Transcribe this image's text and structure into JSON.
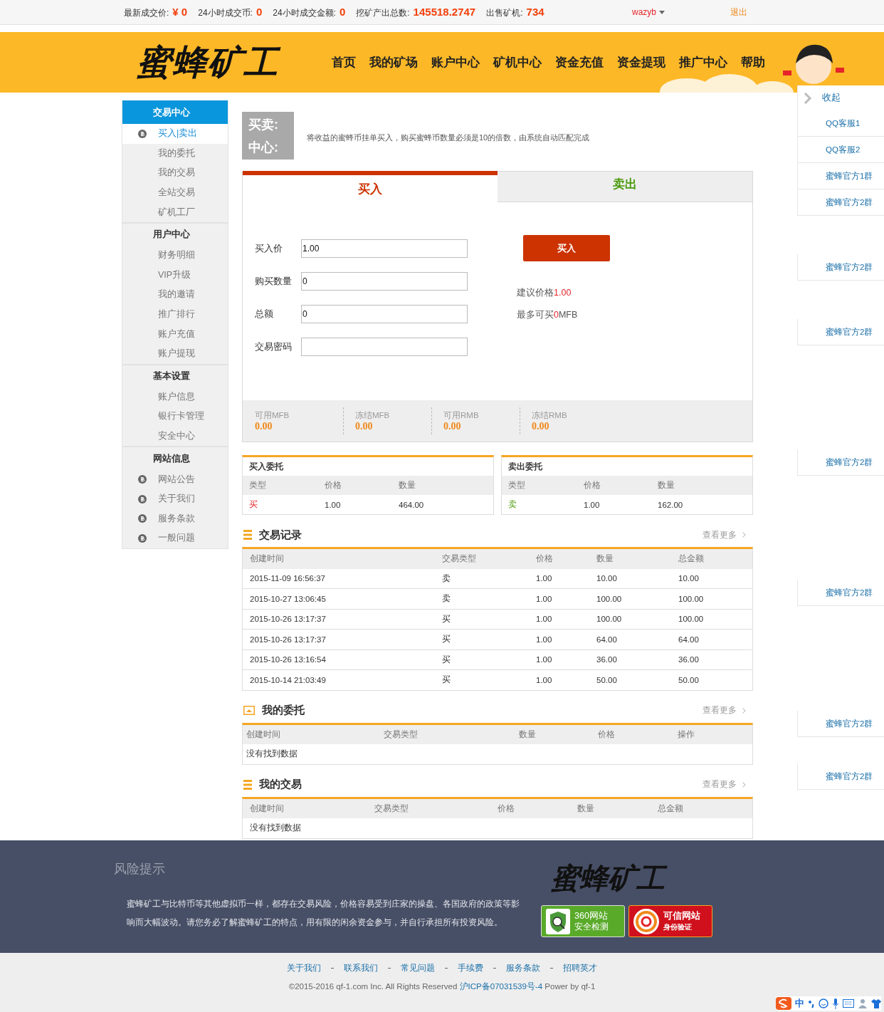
{
  "top_bar": {
    "stats": [
      {
        "label": "最新成交价:",
        "value": "¥ 0"
      },
      {
        "label": "24小时成交币:",
        "value": "0"
      },
      {
        "label": "24小时成交金额:",
        "value": "0"
      },
      {
        "label": "挖矿产出总数:",
        "value": "145518.2747"
      },
      {
        "label": "出售矿机:",
        "value": "734"
      }
    ],
    "user": "wazyb",
    "logout": "退出"
  },
  "header": {
    "logo": "蜜蜂矿工",
    "nav": [
      "首页",
      "我的矿场",
      "账户中心",
      "矿机中心",
      "资金充值",
      "资金提现",
      "推广中心",
      "帮助"
    ]
  },
  "sidebar": {
    "groups": [
      {
        "title": "交易中心",
        "selected": true,
        "items": [
          {
            "label": "买入|卖出",
            "kind": "icon",
            "selected": true
          },
          {
            "label": "我的委托",
            "kind": "plain",
            "selected": false
          },
          {
            "label": "我的交易",
            "kind": "plain",
            "selected": false
          },
          {
            "label": "全站交易",
            "kind": "plain",
            "selected": false
          },
          {
            "label": "矿机工厂",
            "kind": "plain",
            "selected": false
          }
        ]
      },
      {
        "title": "用户中心",
        "selected": false,
        "items": [
          {
            "label": "财务明细",
            "kind": "plain",
            "selected": false
          },
          {
            "label": "VIP升级",
            "kind": "plain",
            "selected": false
          },
          {
            "label": "我的邀请",
            "kind": "plain",
            "selected": false
          },
          {
            "label": "推广排行",
            "kind": "plain",
            "selected": false
          },
          {
            "label": "账户充值",
            "kind": "plain",
            "selected": false
          },
          {
            "label": "账户提现",
            "kind": "plain",
            "selected": false
          }
        ]
      },
      {
        "title": "基本设置",
        "selected": false,
        "items": [
          {
            "label": "账户信息",
            "kind": "plain",
            "selected": false
          },
          {
            "label": "银行卡管理",
            "kind": "plain",
            "selected": false
          },
          {
            "label": "安全中心",
            "kind": "plain",
            "selected": false
          }
        ]
      },
      {
        "title": "网站信息",
        "selected": false,
        "items": [
          {
            "label": "网站公告",
            "kind": "icon",
            "selected": false
          },
          {
            "label": "关于我们",
            "kind": "icon",
            "selected": false
          },
          {
            "label": "服务条款",
            "kind": "icon",
            "selected": false
          },
          {
            "label": "一般问题",
            "kind": "icon",
            "selected": false
          }
        ]
      }
    ]
  },
  "notice": {
    "title": [
      "买卖:",
      "中心:"
    ],
    "text": "将收益的蜜蜂币挂单买入，购买蜜蜂币数量必须是10的倍数，由系统自动匹配完成"
  },
  "trade_panel": {
    "tabs": [
      {
        "label": "买入",
        "kind": "buy",
        "selected": true
      },
      {
        "label": "卖出",
        "kind": "sell",
        "selected": false
      }
    ],
    "fields": [
      {
        "label": "买入价",
        "value": "1.00"
      },
      {
        "label": "购买数量",
        "value": "0"
      },
      {
        "label": "总额",
        "value": "0"
      },
      {
        "label": "交易密码"
      }
    ],
    "submit": "买入",
    "hints": [
      {
        "label": "建议价格",
        "value": "1.00"
      },
      {
        "label": "最多可买",
        "value": "0",
        "unit": "MFB"
      }
    ],
    "balances": [
      {
        "label": "可用MFB",
        "value": "0.00"
      },
      {
        "label": "冻结MFB",
        "value": "0.00"
      },
      {
        "label": "可用RMB",
        "value": "0.00"
      },
      {
        "label": "冻结RMB",
        "value": "0.00"
      }
    ]
  },
  "order_books": [
    {
      "title": "买入委托",
      "columns": [
        "类型",
        "价格",
        "数量"
      ],
      "rows": [
        {
          "type": "买",
          "kind": "buy",
          "price": "1.00",
          "amount": "464.00"
        }
      ]
    },
    {
      "title": "卖出委托",
      "columns": [
        "类型",
        "价格",
        "数量"
      ],
      "rows": [
        {
          "type": "卖",
          "kind": "sell",
          "price": "1.00",
          "amount": "162.00"
        }
      ]
    }
  ],
  "sections": [
    {
      "title": "交易记录",
      "kind": "list",
      "more": "查看更多",
      "columns": [
        "创建时间",
        "交易类型",
        "价格",
        "数量",
        "总金额"
      ],
      "rows": [
        [
          "2015-11-09 16:56:37",
          "卖",
          "1.00",
          "10.00",
          "10.00"
        ],
        [
          "2015-10-27 13:06:45",
          "卖",
          "1.00",
          "100.00",
          "100.00"
        ],
        [
          "2015-10-26 13:17:37",
          "买",
          "1.00",
          "100.00",
          "100.00"
        ],
        [
          "2015-10-26 13:17:37",
          "买",
          "1.00",
          "64.00",
          "64.00"
        ],
        [
          "2015-10-26 13:16:54",
          "买",
          "1.00",
          "36.00",
          "36.00"
        ],
        [
          "2015-10-14 21:03:49",
          "买",
          "1.00",
          "50.00",
          "50.00"
        ]
      ]
    },
    {
      "title": "我的委托",
      "kind": "tray",
      "more": "查看更多",
      "columns": [
        "创建时间",
        "交易类型",
        "数量",
        "价格",
        "操作"
      ],
      "empty": "没有找到数据"
    },
    {
      "title": "我的交易",
      "kind": "list",
      "more": "查看更多",
      "columns": [
        "创建时间",
        "交易类型",
        "价格",
        "数量",
        "总金额"
      ],
      "empty": "没有找到数据"
    }
  ],
  "footer": {
    "risk_title": "风险提示",
    "risk_text": "蜜蜂矿工与比特币等其他虚拟币一样，都存在交易风险，价格容易受到庄家的操盘、各国政府的政策等影响而大幅波动。请您务必了解蜜蜂矿工的特点，用有限的闲余资金参与，并自行承担所有投资风险。",
    "logo": "蜜蜂矿工",
    "badges": [
      {
        "kind": "security",
        "line1": "360网站",
        "line2": "安全检测"
      },
      {
        "kind": "trust",
        "line1": "可信网站",
        "line2": "身份验证"
      }
    ],
    "links": [
      "关于我们",
      "联系我们",
      "常见问题",
      "手续费",
      "服务条款",
      "招聘英才"
    ],
    "copyright": "©2015-2016 qf-1.com Inc. All Rights Reserved",
    "icp": "沪ICP备07031539号-4",
    "power": "Power by qf-1"
  },
  "float_panel": {
    "toggle": "收起",
    "items": [
      "QQ客服1",
      "QQ客服2",
      "蜜蜂官方1群",
      "蜜蜂官方2群",
      "蜜蜂官方2群",
      "蜜蜂官方2群",
      "蜜蜂官方2群",
      "蜜蜂官方2群",
      "蜜蜂官方2群",
      "蜜蜂官方2群"
    ]
  },
  "ime_bar": {
    "mode": "中"
  }
}
